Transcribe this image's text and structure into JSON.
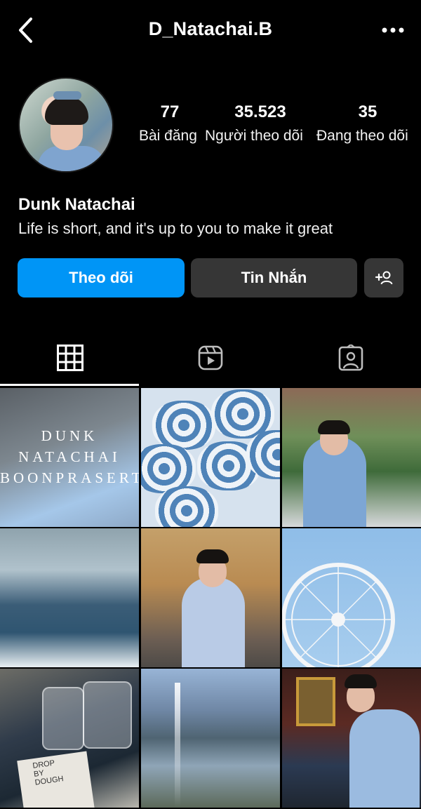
{
  "header": {
    "username": "D_Natachai.B",
    "back_icon": "chevron-left-icon",
    "more_icon": "ellipsis-icon"
  },
  "profile": {
    "display_name": "Dunk Natachai",
    "bio": "Life is short, and it's up to you to make it great",
    "stats": [
      {
        "value": "77",
        "label": "Bài đăng"
      },
      {
        "value": "35.523",
        "label": "Người theo dõi"
      },
      {
        "value": "35",
        "label": "Đang theo dõi"
      }
    ]
  },
  "actions": {
    "follow_label": "Theo dõi",
    "message_label": "Tin Nhắn",
    "add_user_icon": "add-person-icon",
    "follow_color": "#0095f6",
    "secondary_color": "#363636"
  },
  "tabs": [
    {
      "name": "grid",
      "icon": "grid-icon",
      "active": true
    },
    {
      "name": "reels",
      "icon": "reels-icon",
      "active": false
    },
    {
      "name": "tagged",
      "icon": "tagged-person-icon",
      "active": false
    }
  ],
  "grid": {
    "first_post_text": [
      "DUNK",
      "NATACHAI",
      "BOONPRASERT"
    ],
    "menu_card_text": [
      "DROP",
      "BY",
      "DOUGH"
    ]
  }
}
